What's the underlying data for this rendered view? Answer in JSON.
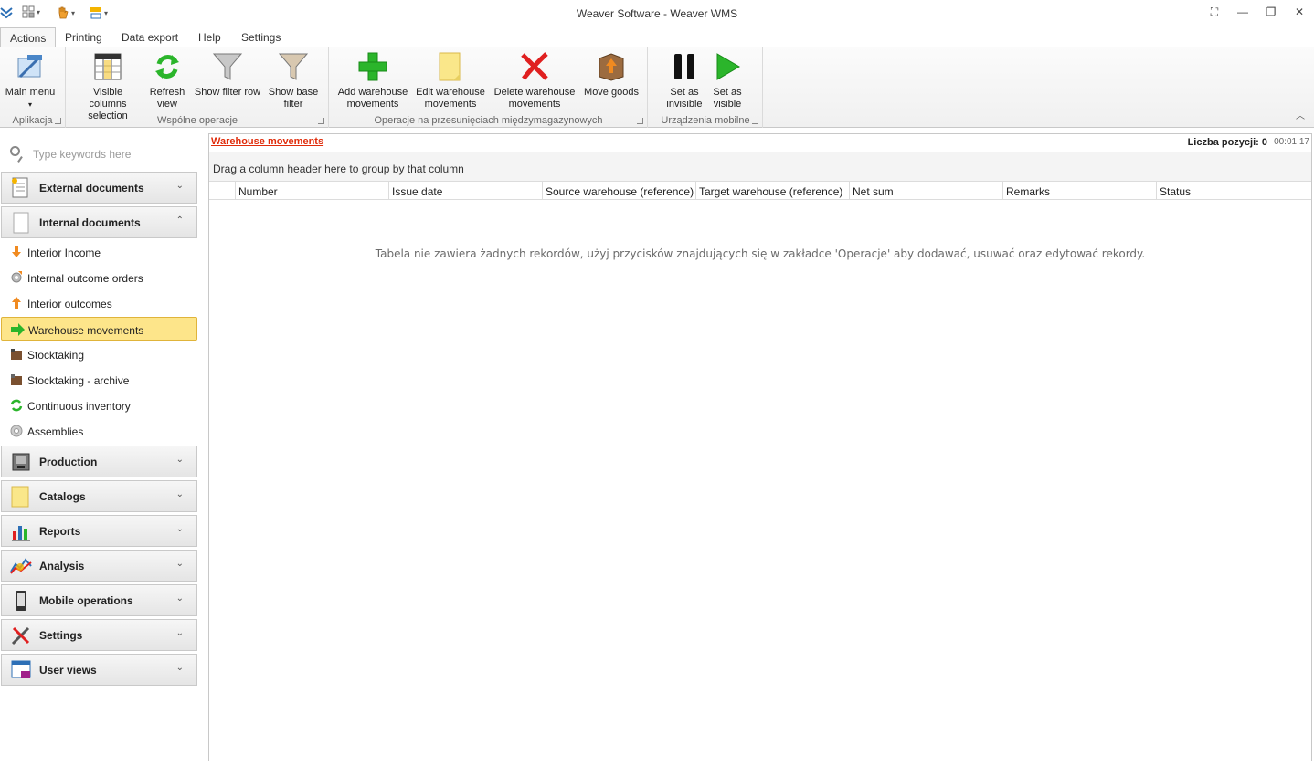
{
  "window": {
    "title": "Weaver Software - Weaver WMS"
  },
  "tabs": [
    {
      "label": "Actions",
      "active": true
    },
    {
      "label": "Printing"
    },
    {
      "label": "Data export"
    },
    {
      "label": "Help"
    },
    {
      "label": "Settings"
    }
  ],
  "ribbon": {
    "groups": [
      {
        "label": "Aplikacja"
      },
      {
        "label": "Wspólne operacje"
      },
      {
        "label": "Operacje na przesunięciach międzymagazynowych"
      },
      {
        "label": "Urządzenia mobilne"
      }
    ],
    "buttons": {
      "main_menu": {
        "line1": "Main menu",
        "line2": "▾"
      },
      "visible_columns": {
        "line1": "Visible columns",
        "line2": "selection"
      },
      "refresh_view": {
        "line1": "Refresh",
        "line2": "view"
      },
      "show_filter_row": {
        "line1": "Show filter row",
        "line2": ""
      },
      "show_base_filter": {
        "line1": "Show base",
        "line2": "filter"
      },
      "add_movements": {
        "line1": "Add warehouse",
        "line2": "movements"
      },
      "edit_movements": {
        "line1": "Edit warehouse",
        "line2": "movements"
      },
      "delete_movements": {
        "line1": "Delete warehouse",
        "line2": "movements"
      },
      "move_goods": {
        "line1": "Move goods",
        "line2": ""
      },
      "set_invisible": {
        "line1": "Set as",
        "line2": "invisible"
      },
      "set_visible": {
        "line1": "Set as",
        "line2": "visible"
      }
    }
  },
  "sidebar": {
    "search_placeholder": "Type keywords here",
    "groups": [
      {
        "label": "External documents",
        "icon": "document-icon",
        "expanded": false
      },
      {
        "label": "Internal documents",
        "icon": "blank-page-icon",
        "expanded": true
      },
      {
        "label": "Production",
        "icon": "machine-icon",
        "expanded": false
      },
      {
        "label": "Catalogs",
        "icon": "note-icon",
        "expanded": false
      },
      {
        "label": "Reports",
        "icon": "bar-chart-icon",
        "expanded": false
      },
      {
        "label": "Analysis",
        "icon": "analysis-icon",
        "expanded": false
      },
      {
        "label": "Mobile operations",
        "icon": "phone-icon",
        "expanded": false
      },
      {
        "label": "Settings",
        "icon": "tools-icon",
        "expanded": false
      },
      {
        "label": "User views",
        "icon": "window-icon",
        "expanded": false
      }
    ],
    "items": [
      {
        "label": "Interior Income",
        "icon": "arrow-down-icon"
      },
      {
        "label": "Internal outcome orders",
        "icon": "gear-arrow-icon"
      },
      {
        "label": "Interior outcomes",
        "icon": "arrow-up-icon"
      },
      {
        "label": "Warehouse movements",
        "icon": "arrow-right-icon",
        "selected": true
      },
      {
        "label": "Stocktaking",
        "icon": "box-icon"
      },
      {
        "label": "Stocktaking - archive",
        "icon": "box-archive-icon"
      },
      {
        "label": "Continuous inventory",
        "icon": "cycle-icon"
      },
      {
        "label": "Assemblies",
        "icon": "gear-icon"
      }
    ]
  },
  "main": {
    "view_title": "Warehouse movements",
    "count_label": "Liczba pozycji: 0",
    "timer": "00:01:17",
    "group_panel_text": "Drag a column header here to group by that column",
    "columns": [
      "Number",
      "Issue date",
      "Source warehouse (reference)",
      "Target warehouse (reference)",
      "Net sum",
      "Remarks",
      "Status"
    ],
    "empty_message": "Tabela nie zawiera żadnych rekordów, użyj przycisków znajdujących się w zakładce 'Operacje' aby dodawać, usuwać oraz edytować rekordy."
  },
  "colors": {
    "accent_title": "#e02c0b",
    "selected_item": "#fde58a",
    "green_icon": "#2bb52b",
    "red_icon": "#e02020"
  }
}
